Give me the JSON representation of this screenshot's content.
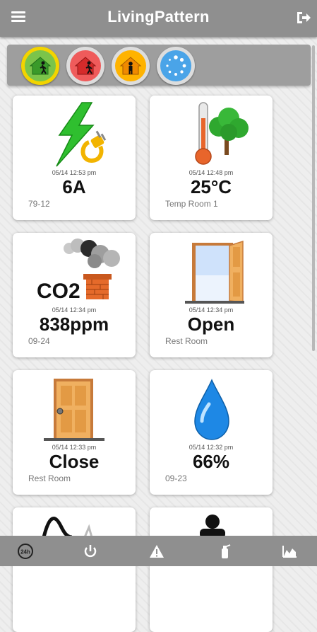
{
  "app": {
    "title": "LivingPattern"
  },
  "icons": {
    "menu": "hamburger-menu-icon",
    "logout": "logout-icon"
  },
  "modes": [
    {
      "name": "at-home",
      "active": true
    },
    {
      "name": "away",
      "active": false
    },
    {
      "name": "home-occupied",
      "active": false
    },
    {
      "name": "loading",
      "active": false
    }
  ],
  "tiles": [
    {
      "timestamp": "05/14 12:53 pm",
      "value": "6A",
      "label": "79-12",
      "icon": "power-plug-icon"
    },
    {
      "timestamp": "05/14 12:48 pm",
      "value": "25°C",
      "label": "Temp Room 1",
      "icon": "thermometer-tree-icon"
    },
    {
      "timestamp": "05/14 12:34 pm",
      "value": "838ppm",
      "label": "09-24",
      "icon": "co2-chimney-icon",
      "icon_text": "CO2"
    },
    {
      "timestamp": "05/14 12:34 pm",
      "value": "Open",
      "label": "Rest Room",
      "icon": "open-door-icon"
    },
    {
      "timestamp": "05/14 12:33 pm",
      "value": "Close",
      "label": "Rest Room",
      "icon": "closed-door-icon"
    },
    {
      "timestamp": "05/14 12:32 pm",
      "value": "66%",
      "label": "09-23",
      "icon": "water-drop-icon"
    }
  ],
  "bottom_nav": [
    {
      "name": "24h-history-icon",
      "text": "24h"
    },
    {
      "name": "power-icon"
    },
    {
      "name": "alert-icon"
    },
    {
      "name": "extinguisher-icon"
    },
    {
      "name": "chart-icon"
    }
  ]
}
